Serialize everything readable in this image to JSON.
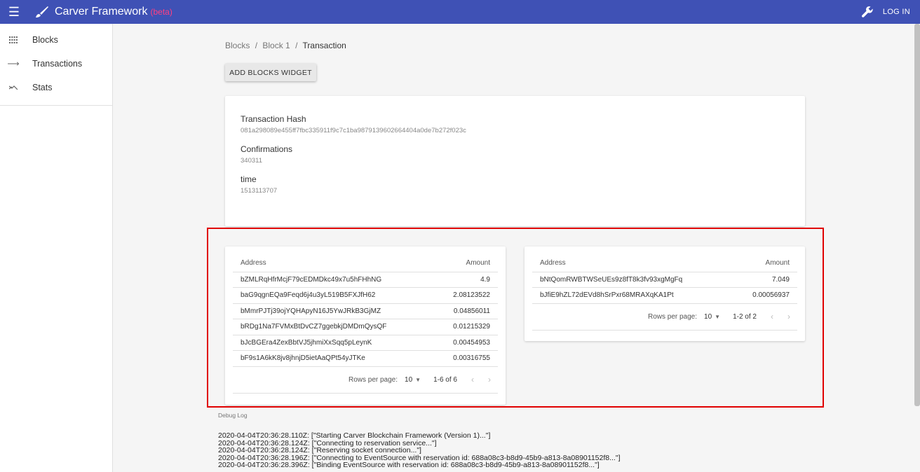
{
  "appbar": {
    "title": "Carver Framework",
    "badge": "(beta)",
    "login_label": "LOG IN",
    "menu_icon": "hamburger-icon",
    "brand_icon": "brush-icon",
    "settings_icon": "wrench-icon",
    "colors": {
      "bar": "#3f51b5",
      "badge": "#ff4081"
    }
  },
  "sidebar": {
    "items": [
      {
        "label": "Blocks",
        "icon": "grid-icon"
      },
      {
        "label": "Transactions",
        "icon": "arrow-right-icon"
      },
      {
        "label": "Stats",
        "icon": "trending-icon"
      }
    ]
  },
  "breadcrumb": {
    "items": [
      "Blocks",
      "Block 1",
      "Transaction"
    ],
    "separator": "/"
  },
  "add_widget_label": "ADD BLOCKS WIDGET",
  "transaction": {
    "hash_label": "Transaction Hash",
    "hash_value": "081a298089e455ff7fbc335911f9c7c1ba9879139602664404a0de7b272f023c",
    "confirmations_label": "Confirmations",
    "confirmations_value": "340311",
    "time_label": "time",
    "time_value": "1513113707"
  },
  "inputs_table": {
    "headers": [
      "Address",
      "Amount"
    ],
    "rows": [
      [
        "bZMLRqHfrMcjF79cEDMDkc49x7u5hFHhNG",
        "4.9"
      ],
      [
        "baG9qgnEQa9Feqd6j4u3yL519B5FXJfH62",
        "2.08123522"
      ],
      [
        "bMmrPJTj39ojYQHApyN16J5YwJRkB3GjMZ",
        "0.04856011"
      ],
      [
        "bRDg1Na7FVMxBtDvCZ7ggebkjDMDmQysQF",
        "0.01215329"
      ],
      [
        "bJcBGEra4ZexBbtVJ5jhmiXxSqq5pLeynK",
        "0.00454953"
      ],
      [
        "bF9s1A6kK8jv8jhnjD5ietAaQPt54yJTKe",
        "0.00316755"
      ]
    ],
    "rows_per_page_label": "Rows per page:",
    "rows_per_page_value": "10",
    "range": "1-6 of 6"
  },
  "outputs_table": {
    "headers": [
      "Address",
      "Amount"
    ],
    "rows": [
      [
        "bNtQomRWBTWSeUEs9z8fT8k3fv93xgMgFq",
        "7.049"
      ],
      [
        "bJfiE9hZL72dEVd8hSrPxr68MRAXqKA1Pt",
        "0.00056937"
      ]
    ],
    "rows_per_page_label": "Rows per page:",
    "rows_per_page_value": "10",
    "range": "1-2 of 2"
  },
  "debug": {
    "label": "Debug Log",
    "lines": [
      "2020-04-04T20:36:28.110Z: [\"Starting Carver Blockchain Framework (Version 1)...\"]",
      "2020-04-04T20:36:28.124Z: [\"Connecting to reservation service...\"]",
      "2020-04-04T20:36:28.124Z: [\"Reserving socket connection...\"]",
      "2020-04-04T20:36:28.196Z: [\"Connecting to EventSource with reservation id: 688a08c3-b8d9-45b9-a813-8a08901152f8...\"]",
      "2020-04-04T20:36:28.396Z: [\"Binding EventSource with reservation id: 688a08c3-b8d9-45b9-a813-8a08901152f8...\"]"
    ]
  }
}
